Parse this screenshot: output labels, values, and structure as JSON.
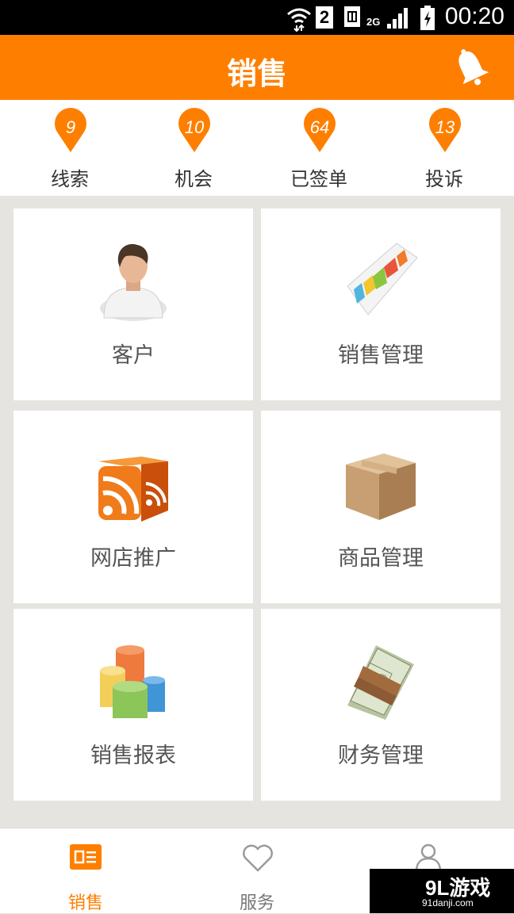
{
  "status_bar": {
    "sim_slot": "2",
    "network": "2G",
    "time": "00:20"
  },
  "header": {
    "title": "销售",
    "bell_icon": "bell-icon"
  },
  "stats": [
    {
      "count": "9",
      "label": "线索"
    },
    {
      "count": "10",
      "label": "机会"
    },
    {
      "count": "64",
      "label": "已签单"
    },
    {
      "count": "13",
      "label": "投诉"
    }
  ],
  "modules": [
    {
      "label": "客户",
      "icon": "customer-icon"
    },
    {
      "label": "销售管理",
      "icon": "sales-management-icon"
    },
    {
      "label": "网店推广",
      "icon": "rss-icon"
    },
    {
      "label": "商品管理",
      "icon": "box-icon"
    },
    {
      "label": "销售报表",
      "icon": "report-chart-icon"
    },
    {
      "label": "财务管理",
      "icon": "money-icon"
    }
  ],
  "tabbar": {
    "tabs": [
      {
        "label": "销售",
        "active": true
      },
      {
        "label": "服务",
        "active": false
      },
      {
        "label": "",
        "active": false
      }
    ]
  },
  "watermark": {
    "main": "9L游戏",
    "sub": "91danji.com"
  },
  "colors": {
    "accent": "#fe7f00",
    "background": "#e6e4e0"
  }
}
